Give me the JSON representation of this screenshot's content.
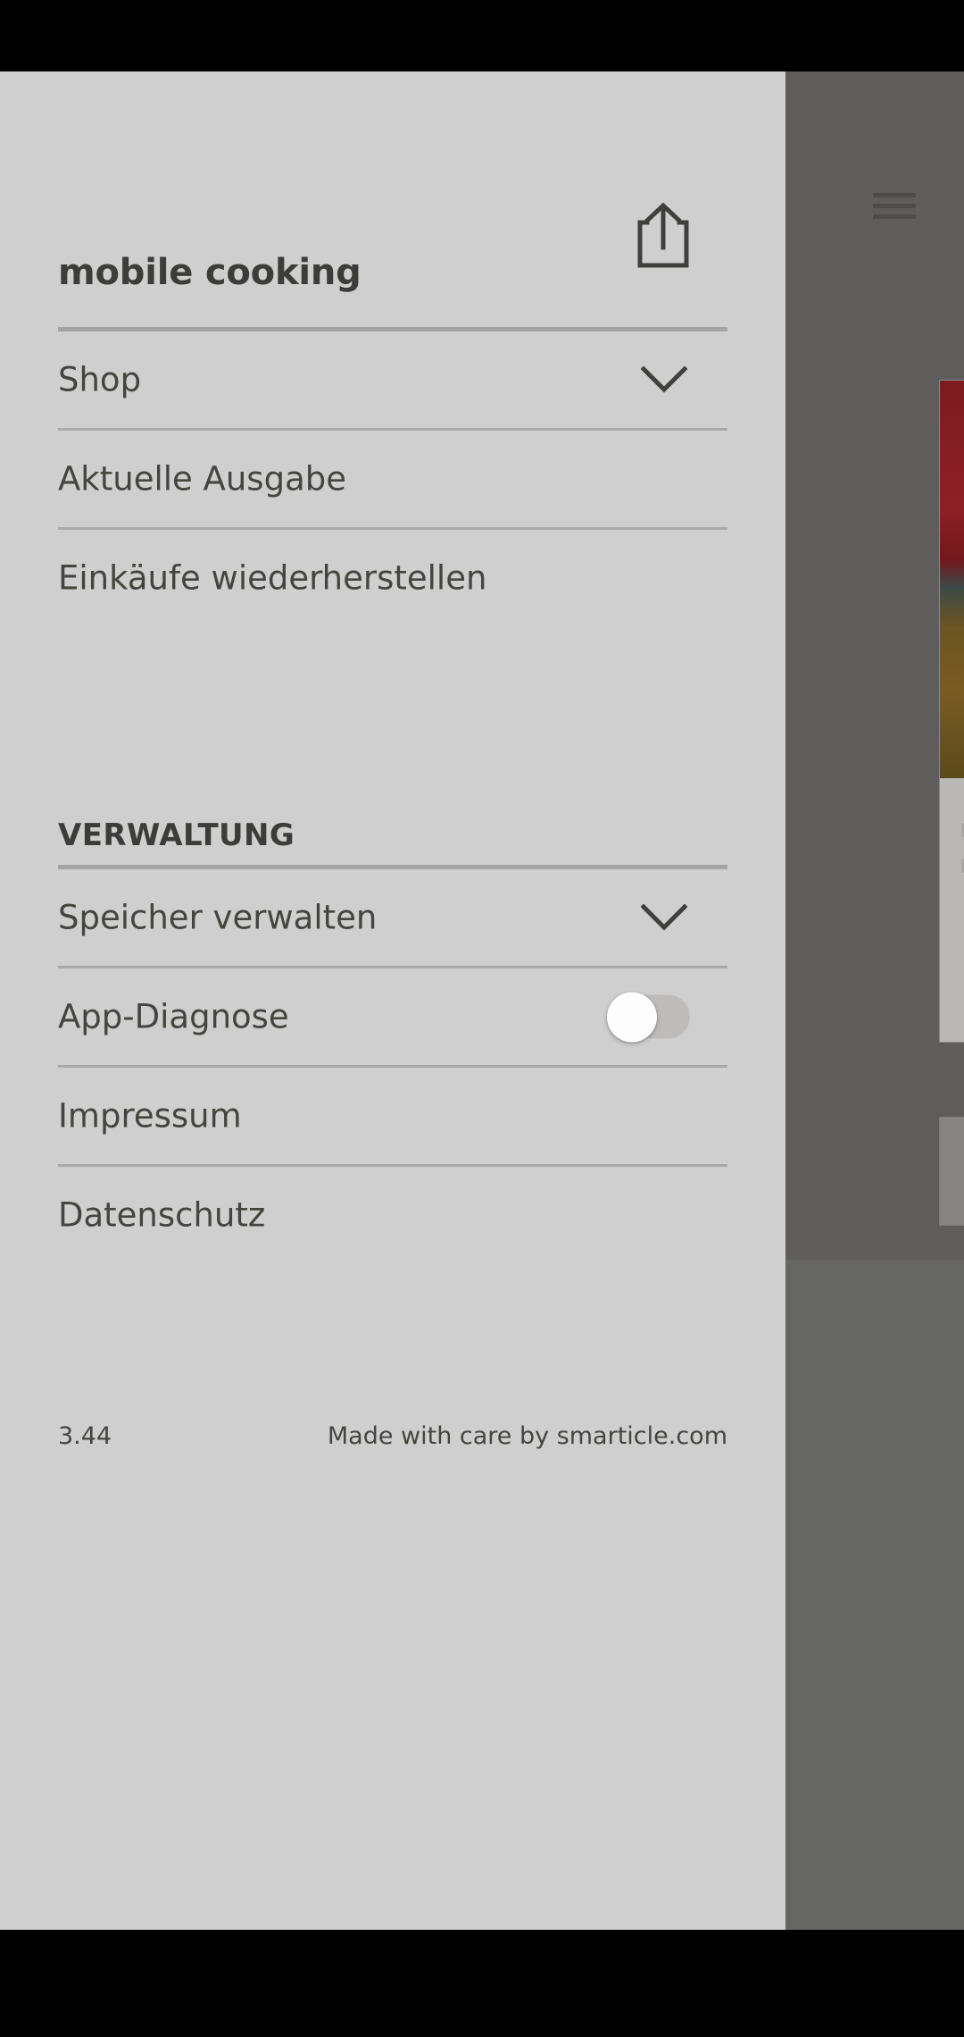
{
  "app": {
    "brand_title": "mobile cooking",
    "share_icon": "share-icon",
    "menu_icon": "hamburger-menu-icon"
  },
  "drawer": {
    "primary_items": [
      {
        "label": "Shop",
        "accessory": "chevron-down-icon"
      },
      {
        "label": "Aktuelle Ausgabe",
        "accessory": "none"
      },
      {
        "label": "Einkäufe wiederherstellen",
        "accessory": "none"
      }
    ],
    "section": {
      "title": "VERWALTUNG",
      "items": [
        {
          "label": "Speicher verwalten",
          "accessory": "chevron-down-icon"
        },
        {
          "label": "App-Diagnose",
          "accessory": "toggle",
          "toggle_on": false
        },
        {
          "label": "Impressum",
          "accessory": "none"
        },
        {
          "label": "Datenschutz",
          "accessory": "none"
        }
      ]
    },
    "footer": {
      "version": "3.44",
      "credit": "Made with care by smarticle.com"
    }
  },
  "colors": {
    "drawer_background": "#cfcfcf",
    "text_primary": "#3c3d39",
    "text_body": "#45453f",
    "divider": "#a4a4a4",
    "scrim": "#5e5d5b",
    "toggle_track_off": "#bdbcba",
    "toggle_knob": "#fdfdfd",
    "system_bar": "#000000"
  }
}
